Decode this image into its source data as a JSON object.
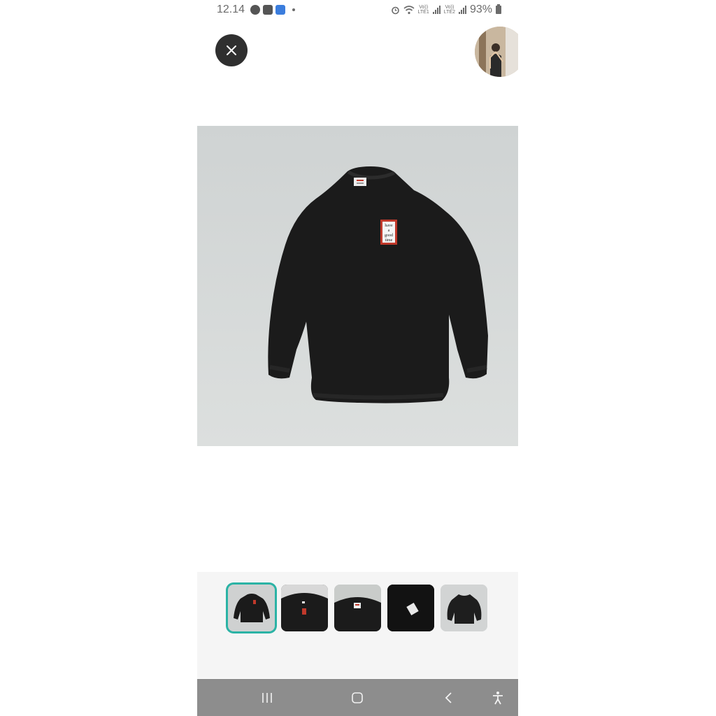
{
  "status_bar": {
    "time": "12.14",
    "left_icons": [
      "messenger-icon",
      "app-icon",
      "mail-icon"
    ],
    "lte1_label_top": "Vo))",
    "lte1_label_bottom": "LTE1",
    "lte2_label_top": "Vo))",
    "lte2_label_bottom": "LTE2",
    "battery_percent": "93%"
  },
  "header": {
    "close_icon": "close-icon",
    "avatar_icon": "profile-avatar"
  },
  "product_image": {
    "label_line1": "have",
    "label_line2": "a",
    "label_line3": "good",
    "label_line4": "time"
  },
  "thumbnails": {
    "selected_index": 0,
    "items": [
      "thumbnail-1",
      "thumbnail-2",
      "thumbnail-3",
      "thumbnail-4",
      "thumbnail-5"
    ]
  },
  "nav_bar": {
    "icons": [
      "recents-icon",
      "home-icon",
      "back-icon",
      "accessibility-icon"
    ]
  },
  "colors": {
    "selected_border": "#2bb3a5",
    "close_button_bg": "#2f2f2f",
    "nav_bar_bg": "#8d8d8d"
  }
}
